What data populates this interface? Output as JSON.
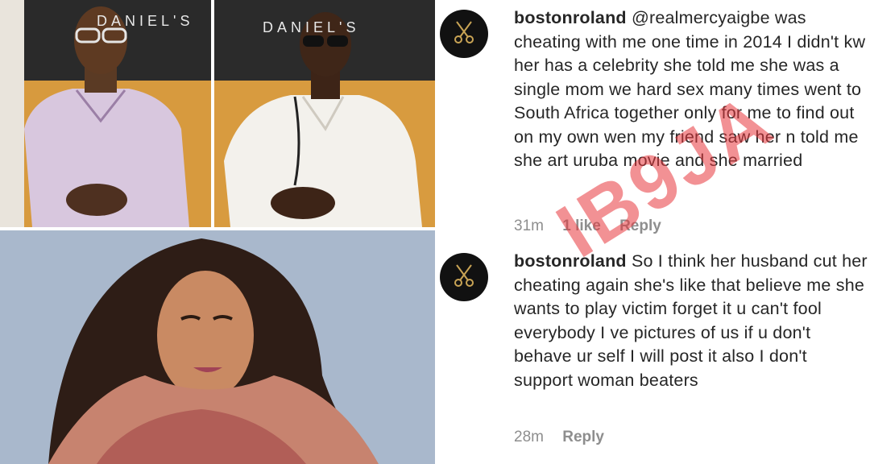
{
  "photos": {
    "top_left_sign": "DANIEL'S",
    "top_right_sign": "DANIEL'S"
  },
  "comments": [
    {
      "username": "bostonroland",
      "text": "@realmercyaigbe was cheating with me one time in 2014 I didn't kw her has a celebrity she told me she was a single mom we hard sex many times went to South Africa together only for me to find out on my own  wen my friend saw her n told me she art uruba movie and she married",
      "time": "31m",
      "likes": "1 like",
      "reply": "Reply"
    },
    {
      "username": "bostonroland",
      "text": "So I think her husband cut her cheating again she's like that believe me she wants to play victim forget it u can't fool everybody I ve pictures of us if u don't behave ur self I will post it also I don't support woman beaters",
      "time": "28m",
      "reply": "Reply"
    }
  ],
  "watermark": "IB9JA",
  "colors": {
    "watermark": "#e8373c",
    "meta": "#8e8e8e",
    "text": "#262626"
  }
}
